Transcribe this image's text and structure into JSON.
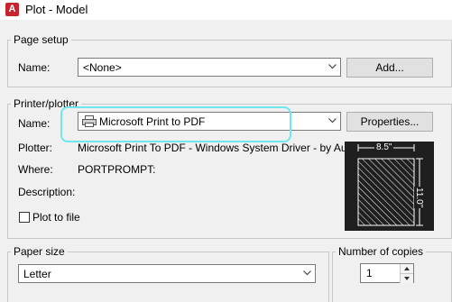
{
  "window": {
    "title": "Plot - Model",
    "app_icon_letter": "A"
  },
  "page_setup": {
    "legend": "Page setup",
    "name_label": "Name:",
    "name_value": "<None>",
    "add_button": "Add..."
  },
  "printer": {
    "legend": "Printer/plotter",
    "name_label": "Name:",
    "name_value": "Microsoft Print to PDF",
    "properties_button": "Properties...",
    "plotter_label": "Plotter:",
    "plotter_value": "Microsoft Print To PDF - Windows System Driver - by Au...",
    "where_label": "Where:",
    "where_value": "PORTPROMPT:",
    "description_label": "Description:",
    "plot_to_file_label": "Plot to file",
    "preview_width": "8.5\"",
    "preview_height": "11.0\""
  },
  "paper_size": {
    "legend": "Paper size",
    "value": "Letter"
  },
  "copies": {
    "legend": "Number of copies",
    "value": "1"
  },
  "colors": {
    "highlight": "#6ee8ee",
    "app_icon": "#c8242f"
  }
}
